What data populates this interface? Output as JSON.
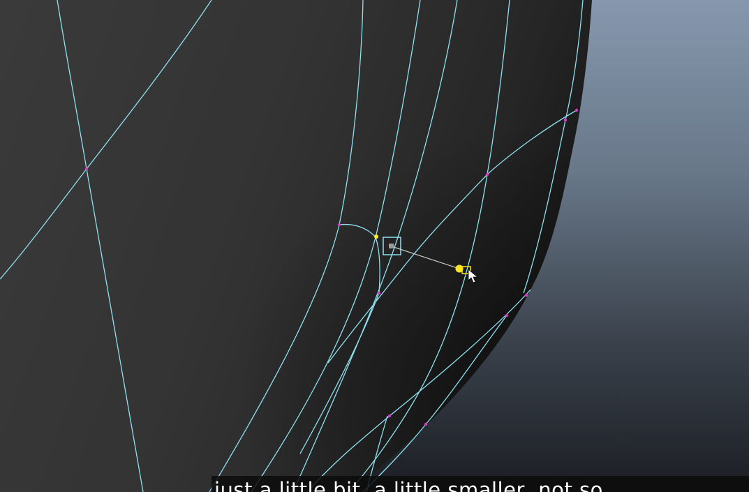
{
  "app": {
    "view": "3D viewport",
    "background_gradient": [
      "#8a9ab0",
      "#5d6b7c",
      "#1a1d22"
    ],
    "mesh_fill": "#333333",
    "wire_color": "#8ee2f0",
    "vertex_color": "#d23cc8",
    "selected_vertex_color": "#ffee22"
  },
  "tool": {
    "name": "CV handle manipulator",
    "handle_icon": "square-handle-icon",
    "cursor_icon": "arrow-cursor-icon"
  },
  "subtitle": {
    "text": "just a little bit, a little smaller, not so"
  }
}
